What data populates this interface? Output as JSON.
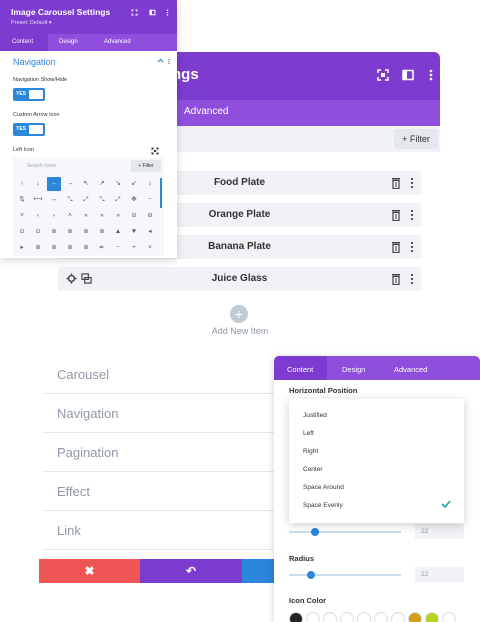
{
  "bg_modal": {
    "title": "ngs",
    "tab_advanced": "Advanced",
    "filter_label": "+ Filter",
    "items": [
      {
        "label": "Food Plate"
      },
      {
        "label": "Orange Plate"
      },
      {
        "label": "Banana Plate"
      },
      {
        "label": "Juice Glass"
      }
    ],
    "add_new_label": "Add New Item",
    "add_new_symbol": "+"
  },
  "panel": {
    "title": "Image Carousel Settings",
    "preset": "Preset: Default ▾",
    "tabs": [
      "Content",
      "Design",
      "Advanced"
    ],
    "section_title": "Navigation",
    "nav_show_hide_label": "Navigation Show/Hide",
    "nav_toggle_value": "YES",
    "custom_arrow_label": "Custom Arrow Icon",
    "arrow_toggle_value": "YES",
    "left_icon_label": "Left Icon",
    "search_placeholder": "Search Icons",
    "filter_label": "+ Filter",
    "glyphs": [
      [
        "↑",
        "↓",
        "←",
        "→",
        "↖",
        "↗",
        "↘",
        "↙",
        "↕"
      ],
      [
        "⇅",
        "⟷",
        "↔",
        "⤡",
        "⤢",
        "⤡",
        "⤢",
        "✥",
        "−"
      ],
      [
        "˅",
        "‹",
        "›",
        "˄",
        "«",
        "«",
        "»",
        "⊝",
        "⊖"
      ],
      [
        "⊙",
        "⊙",
        "⊚",
        "⊚",
        "⊚",
        "⊚",
        "▲",
        "▼",
        "◂"
      ],
      [
        "▸",
        "⊛",
        "⊛",
        "⊛",
        "⊛",
        "↞",
        "−",
        "+",
        "×"
      ]
    ],
    "selected_glyph": "←"
  },
  "menu": {
    "items": [
      "Carousel",
      "Navigation",
      "Pagination",
      "Effect",
      "Link"
    ]
  },
  "bottom_bar": {
    "cancel_symbol": "✖",
    "undo_symbol": "↶",
    "colors": {
      "cancel": "#ef5555",
      "undo": "#7e3bd0",
      "save": "#2b87da"
    }
  },
  "right_panel": {
    "tabs": [
      "Content",
      "Design",
      "Advanced"
    ],
    "horizontal_position_label": "Horizontal Position",
    "options": [
      "Justified",
      "Left",
      "Right",
      "Center",
      "Space Around",
      "Space Evenly"
    ],
    "selected_option": "Space Evenly",
    "slider1_value": "22",
    "radius_label": "Radius",
    "radius_value": "22",
    "radius_level": 0.2,
    "icon_color_label": "Icon Color",
    "swatches": [
      "#222222",
      "#ffffff",
      "#ffffff",
      "#ffffff",
      "#ffffff",
      "#ffffff",
      "#ffffff",
      "#d4a017",
      "#b7d31f",
      "#ffffff"
    ]
  },
  "colors": {
    "purple": "#7e3bd0",
    "purple_light": "#8f4fdc",
    "blue": "#2b87da",
    "red": "#ef5555"
  }
}
